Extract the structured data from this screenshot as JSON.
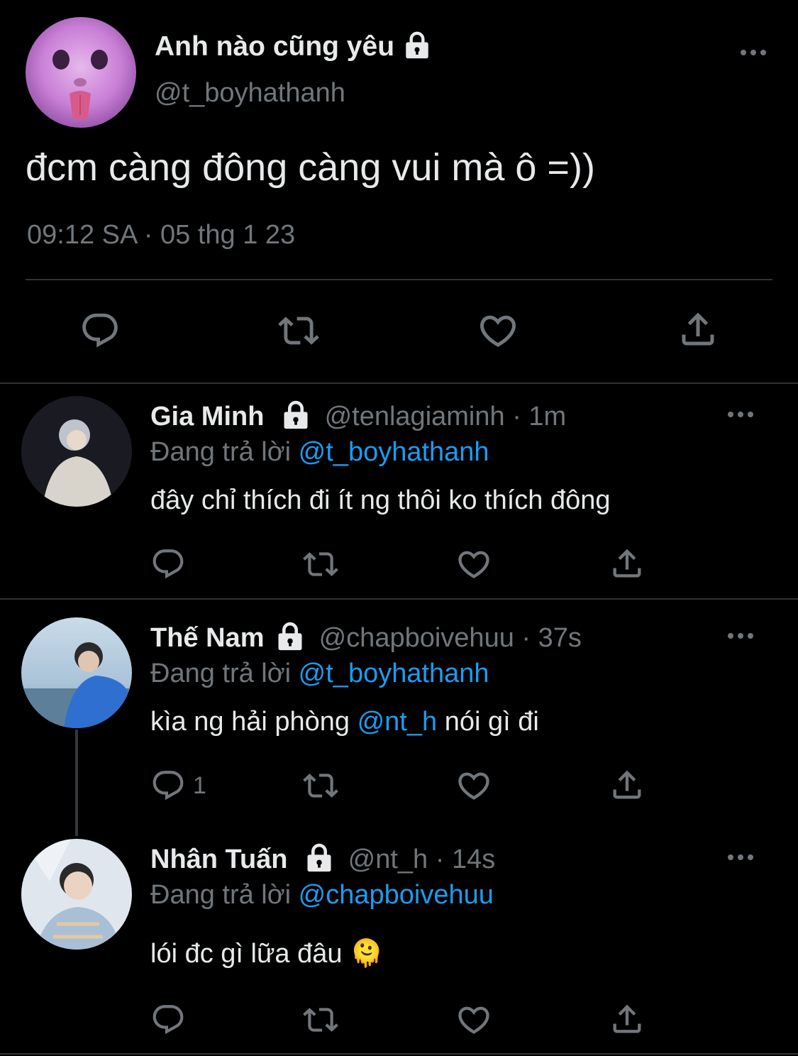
{
  "main_tweet": {
    "display_name": "Anh nào cũng yêu",
    "handle": "@t_boyhathanh",
    "text": "đcm càng đông càng vui mà ô =))",
    "timestamp": "09:12 SA · 05 thg 1 23"
  },
  "replies": [
    {
      "display_name": "Gia Minh",
      "handle": "@tenlagiaminh",
      "time": "· 1m",
      "replying_prefix": "Đang trả lời",
      "replying_to": "@t_boyhathanh",
      "text": "đây chỉ thích đi ít ng thôi ko thích đông",
      "reply_count": ""
    },
    {
      "display_name": "Thế Nam",
      "handle": "@chapboivehuu",
      "time": "· 37s",
      "replying_prefix": "Đang trả lời",
      "replying_to": "@t_boyhathanh",
      "text_before": "kìa ng hải phòng",
      "mention": "@nt_h",
      "text_after": "nói gì đi",
      "reply_count": "1"
    },
    {
      "display_name": "Nhân Tuấn",
      "handle": "@nt_h",
      "time": "· 14s",
      "replying_prefix": "Đang trả lời",
      "replying_to": "@chapboivehuu",
      "text": "lói đc gì lữa đâu",
      "emoji": "🫠",
      "reply_count": ""
    }
  ],
  "colors": {
    "background": "#000000",
    "text": "#e7e9ea",
    "muted": "#71767b",
    "link": "#1d9bf0",
    "divider": "#2f3336"
  },
  "icons": [
    "comment-icon",
    "retweet-icon",
    "like-icon",
    "share-icon",
    "lock-icon",
    "more-icon"
  ]
}
